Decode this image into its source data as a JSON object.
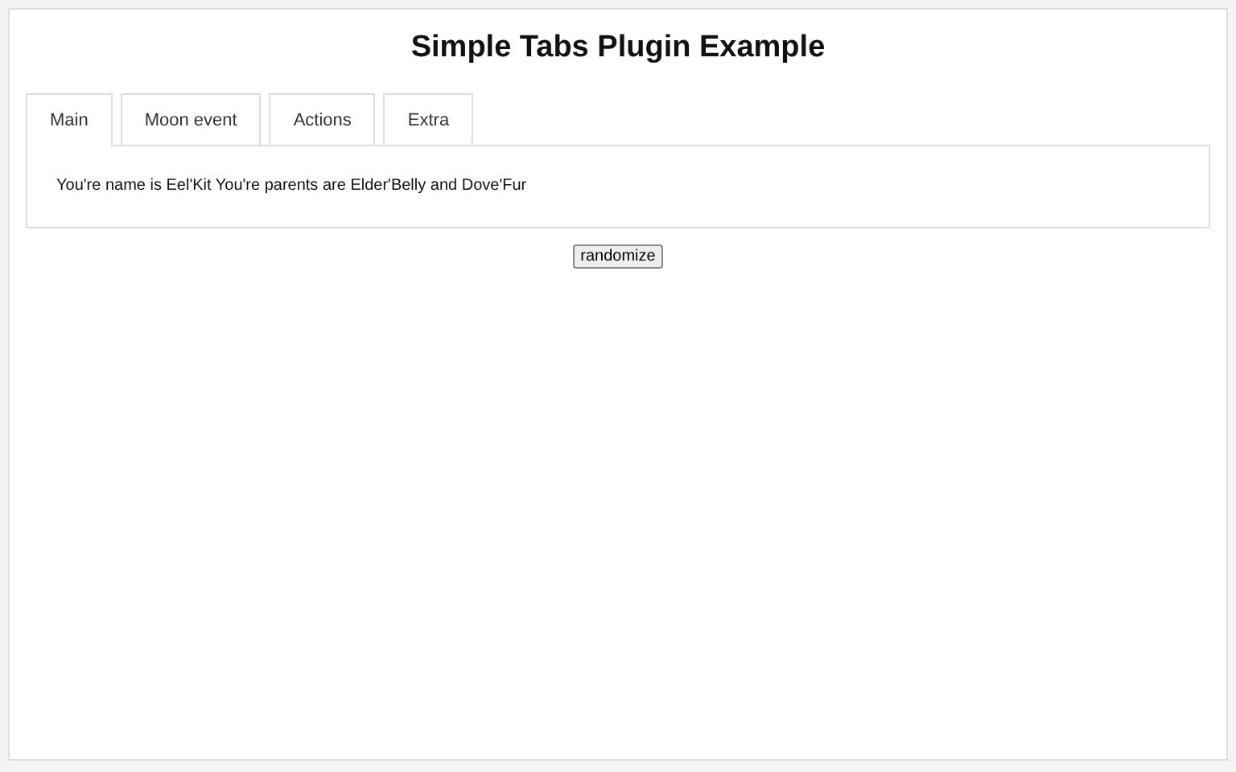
{
  "title": "Simple Tabs Plugin Example",
  "tabs": [
    {
      "label": "Main",
      "selected": true
    },
    {
      "label": "Moon event",
      "selected": false
    },
    {
      "label": "Actions",
      "selected": false
    },
    {
      "label": "Extra",
      "selected": false
    }
  ],
  "panel_text": "You're name is Eel'Kit You're parents are Elder'Belly and Dove'Fur",
  "button": "randomize"
}
